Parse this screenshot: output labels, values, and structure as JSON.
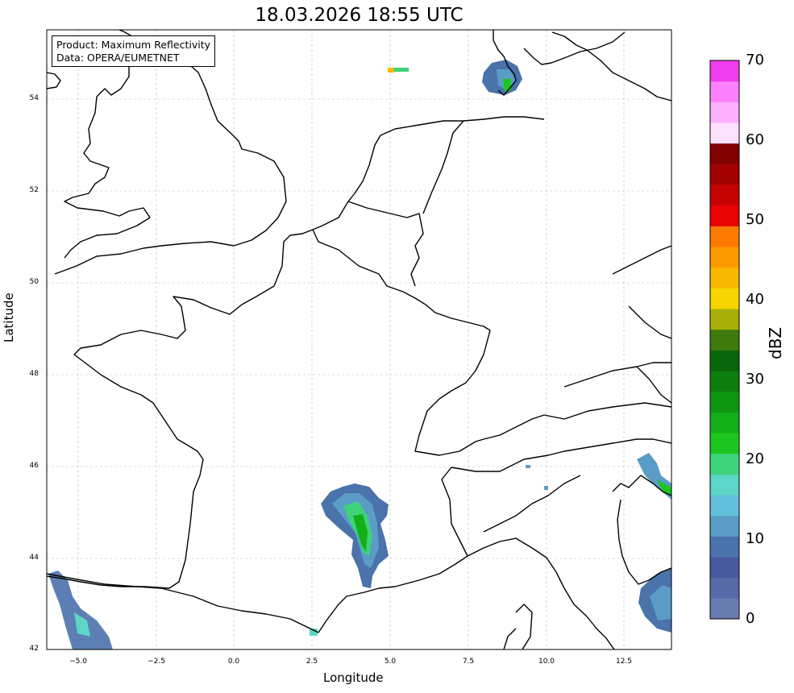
{
  "title": "18.03.2026 18:55 UTC",
  "info": {
    "product": "Product: Maximum Reflectivity",
    "data": "Data: OPERA/EUMETNET"
  },
  "axes": {
    "xlabel": "Longitude",
    "ylabel": "Latitude",
    "xticks": [
      "−5.0",
      "−2.5",
      "0.0",
      "2.5",
      "5.0",
      "7.5",
      "10.0",
      "12.5"
    ],
    "yticks": [
      "54",
      "52",
      "50",
      "48",
      "46",
      "44",
      "42"
    ],
    "xlim": [
      -6,
      14
    ],
    "ylim": [
      42,
      55.5
    ]
  },
  "colorbar": {
    "label": "dBZ",
    "ticks": [
      "70",
      "60",
      "50",
      "40",
      "30",
      "20",
      "10",
      "0"
    ],
    "colors": [
      "#6a7bb0",
      "#5a6aa8",
      "#4a5aa0",
      "#4a72ab",
      "#5a9cc6",
      "#62c0db",
      "#5cd6c6",
      "#3ed27a",
      "#1cc620",
      "#14ae18",
      "#0e9612",
      "#0c7e0e",
      "#0a660a",
      "#3e7a0c",
      "#a8b00a",
      "#f6d602",
      "#fbb802",
      "#fc9a02",
      "#fc7a02",
      "#e80202",
      "#c60202",
      "#a40202",
      "#820202",
      "#fce0fc",
      "#fcb0fc",
      "#fc80fc",
      "#ee3eee"
    ]
  },
  "colors": {
    "border": "#000000",
    "grid": "#bbbbbb"
  }
}
